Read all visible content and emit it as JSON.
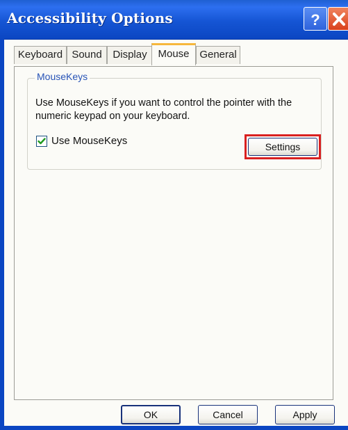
{
  "window": {
    "title": "Accessibility Options",
    "help_icon": "question-mark-icon",
    "close_icon": "close-x-icon",
    "colors": {
      "titlebar": "#1555d4",
      "close_button": "#d9401c",
      "active_tab_accent": "#f6b73c",
      "highlight": "#d92020",
      "group_title": "#2753b6"
    }
  },
  "tabs": [
    {
      "label": "Keyboard",
      "active": false
    },
    {
      "label": "Sound",
      "active": false
    },
    {
      "label": "Display",
      "active": false
    },
    {
      "label": "Mouse",
      "active": true
    },
    {
      "label": "General",
      "active": false
    }
  ],
  "mousekeys": {
    "group_title": "MouseKeys",
    "description": "Use MouseKeys if you want to control the pointer with the numeric keypad on your keyboard.",
    "checkbox_label": "Use MouseKeys",
    "checked": true,
    "settings_label": "Settings"
  },
  "footer": {
    "ok_label": "OK",
    "cancel_label": "Cancel",
    "apply_label": "Apply"
  }
}
